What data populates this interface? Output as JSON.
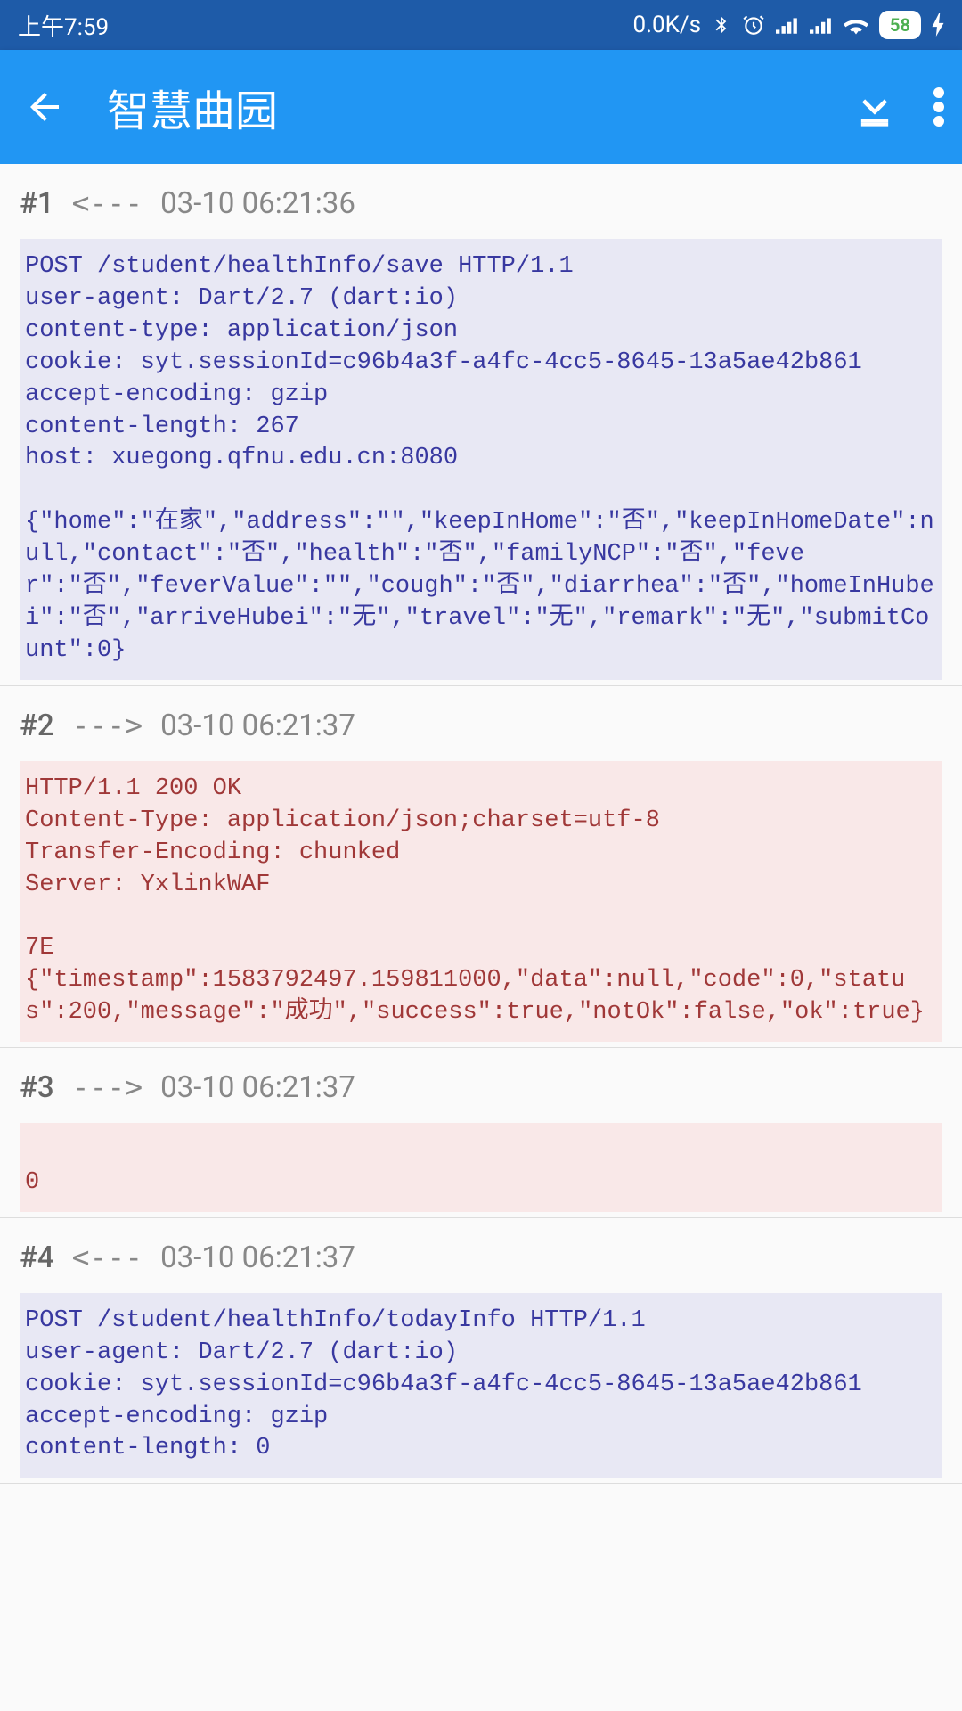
{
  "status_bar": {
    "time": "上午7:59",
    "speed": "0.0K/s",
    "battery": "58"
  },
  "app_bar": {
    "title": "智慧曲园"
  },
  "entries": [
    {
      "num": "#1",
      "dir": "<---",
      "time": "03-10 06:21:36",
      "type": "request",
      "body": "POST /student/healthInfo/save HTTP/1.1\nuser-agent: Dart/2.7 (dart:io)\ncontent-type: application/json\ncookie: syt.sessionId=c96b4a3f-a4fc-4cc5-8645-13a5ae42b861\naccept-encoding: gzip\ncontent-length: 267\nhost: xuegong.qfnu.edu.cn:8080\n\n{\"home\":\"在家\",\"address\":\"\",\"keepInHome\":\"否\",\"keepInHomeDate\":null,\"contact\":\"否\",\"health\":\"否\",\"familyNCP\":\"否\",\"fever\":\"否\",\"feverValue\":\"\",\"cough\":\"否\",\"diarrhea\":\"否\",\"homeInHubei\":\"否\",\"arriveHubei\":\"无\",\"travel\":\"无\",\"remark\":\"无\",\"submitCount\":0}"
    },
    {
      "num": "#2",
      "dir": "--->",
      "time": "03-10 06:21:37",
      "type": "response",
      "body": "HTTP/1.1 200 OK\nContent-Type: application/json;charset=utf-8\nTransfer-Encoding: chunked\nServer: YxlinkWAF\n\n7E\n{\"timestamp\":1583792497.159811000,\"data\":null,\"code\":0,\"status\":200,\"message\":\"成功\",\"success\":true,\"notOk\":false,\"ok\":true}"
    },
    {
      "num": "#3",
      "dir": "--->",
      "time": "03-10 06:21:37",
      "type": "response",
      "body": "\n0\n"
    },
    {
      "num": "#4",
      "dir": "<---",
      "time": "03-10 06:21:37",
      "type": "request",
      "body": "POST /student/healthInfo/todayInfo HTTP/1.1\nuser-agent: Dart/2.7 (dart:io)\ncookie: syt.sessionId=c96b4a3f-a4fc-4cc5-8645-13a5ae42b861\naccept-encoding: gzip\ncontent-length: 0"
    }
  ]
}
